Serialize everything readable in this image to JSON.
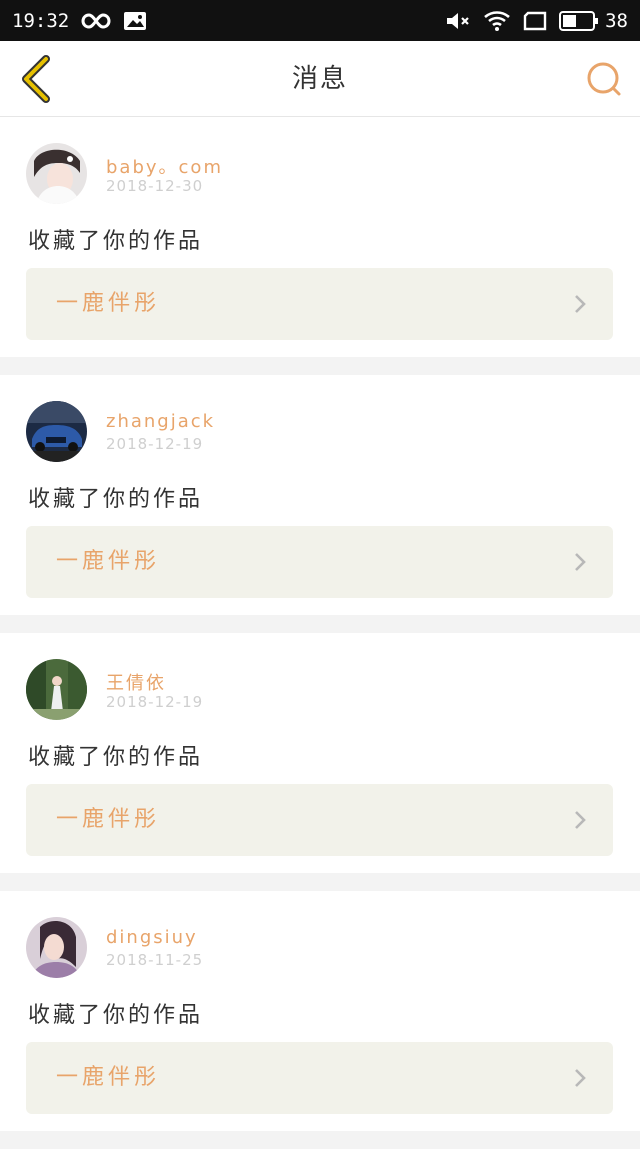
{
  "statusbar": {
    "time": "19:32",
    "battery": "38",
    "icons": [
      "infinity-icon",
      "image-icon",
      "mute-icon",
      "wifi-icon",
      "screen-icon",
      "battery-icon"
    ]
  },
  "navbar": {
    "title": "消息",
    "back_icon": "chevron-left-icon",
    "search_icon": "search-icon",
    "accent": "#e8a46a",
    "back_color": "#e6c000"
  },
  "messages": [
    {
      "username": "baby。com",
      "date": "2018-12-30",
      "action": "收藏了你的作品",
      "work_title": "一鹿伴彤"
    },
    {
      "username": "zhangjack",
      "date": "2018-12-19",
      "action": "收藏了你的作品",
      "work_title": "一鹿伴彤"
    },
    {
      "username": "王倩依",
      "date": "2018-12-19",
      "action": "收藏了你的作品",
      "work_title": "一鹿伴彤"
    },
    {
      "username": "dingsiuy",
      "date": "2018-11-25",
      "action": "收藏了你的作品",
      "work_title": "一鹿伴彤"
    }
  ]
}
